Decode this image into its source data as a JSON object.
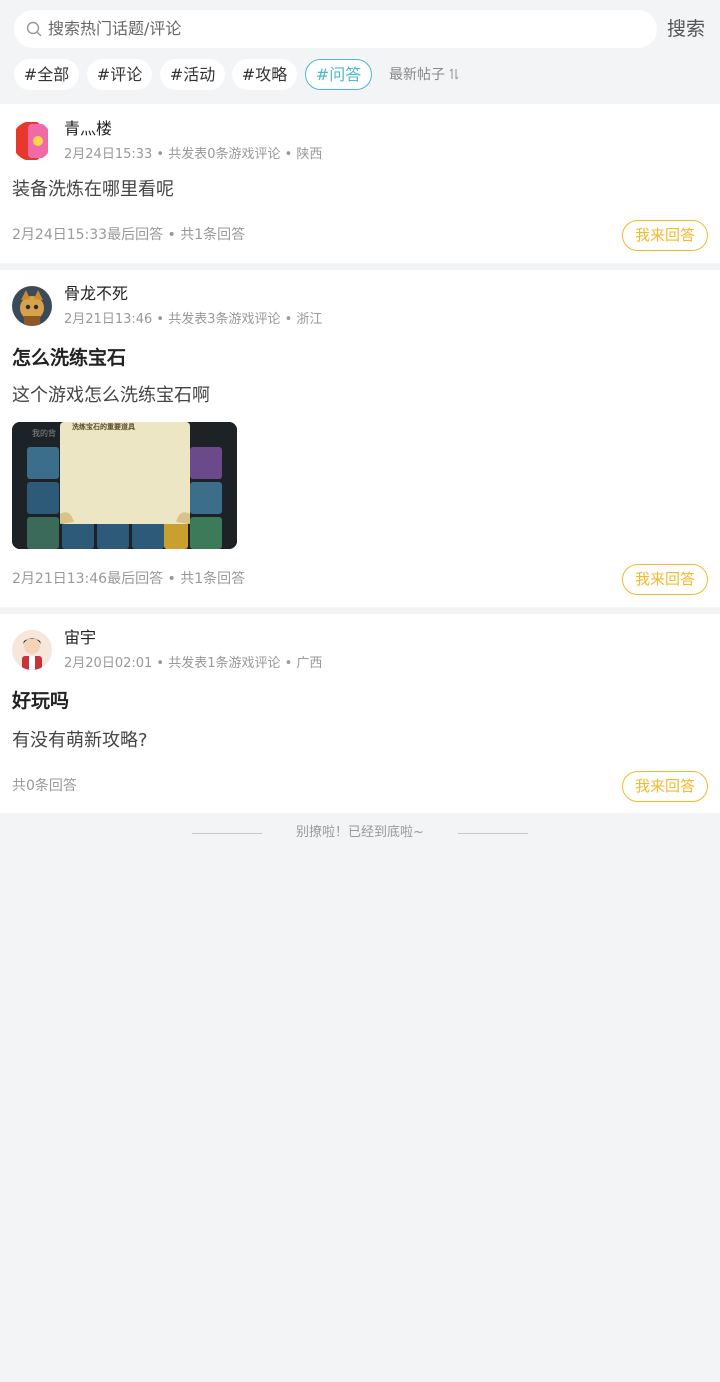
{
  "search": {
    "placeholder": "搜索热门话题/评论",
    "button": "搜索"
  },
  "filters": {
    "chips": [
      "#全部",
      "#评论",
      "#活动",
      "#攻略",
      "#问答"
    ],
    "active": "#问答",
    "sort_label": "最新帖子",
    "sort_icon": "sort-arrows-icon"
  },
  "posts": [
    {
      "username": "青灬楼",
      "meta": "2月24日15:33 • 共发表0条游戏评论 • 陕西",
      "title": "",
      "body": "装备洗炼在哪里看呢",
      "footer": "2月24日15:33最后回答 • 共1条回答",
      "answer_button": "我来回答"
    },
    {
      "username": "骨龙不死",
      "meta": "2月21日13:46 • 共发表3条游戏评论 • 浙江",
      "title": "怎么洗练宝石",
      "body": "这个游戏怎么洗练宝石啊",
      "image_caption": "洗练宝石的重要道具",
      "image_corner": "我的背",
      "footer": "2月21日13:46最后回答 • 共1条回答",
      "answer_button": "我来回答"
    },
    {
      "username": "宙宇",
      "meta": "2月20日02:01 • 共发表1条游戏评论 • 广西",
      "title": "好玩吗",
      "body": "有没有萌新攻略?",
      "footer": "共0条回答",
      "answer_button": "我来回答"
    }
  ],
  "end_note": "别撩啦！已经到底啦~",
  "colors": {
    "accent_teal": "#4fb8c9",
    "answer_orange": "#f5b82e",
    "background": "#f3f4f6"
  }
}
